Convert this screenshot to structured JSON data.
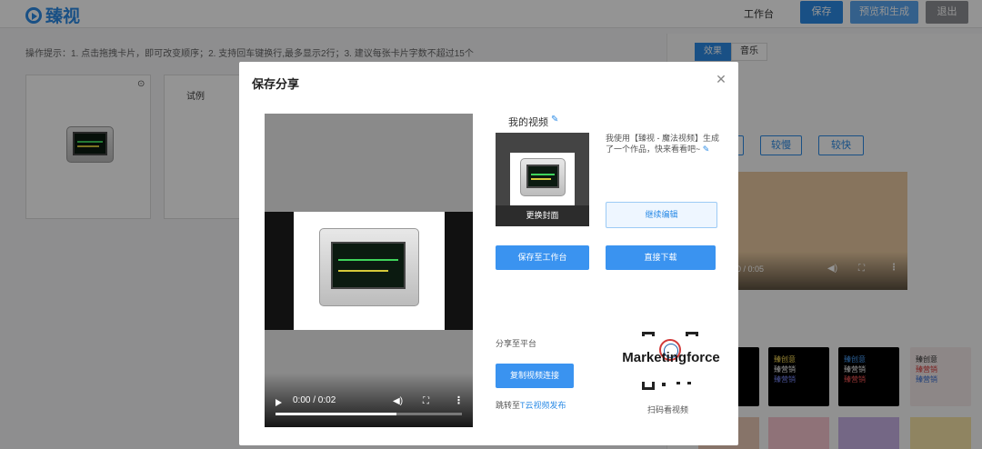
{
  "app": {
    "logo_text": "臻视",
    "nav_workbench": "工作台",
    "btn_save": "保存",
    "btn_preview": "预览和生成",
    "btn_exit": "退出"
  },
  "colors": {
    "primary": "#3a93f0",
    "header_blue": "#2b8be6",
    "exit_gray": "#8d9095"
  },
  "background": {
    "tips": "操作提示：1. 点击拖拽卡片，即可改变顺序；2. 支持回车键换行,最多显示2行；3. 建议每张卡片字数不超过15个",
    "card2_label": "试例",
    "tabs": [
      "效果",
      "音乐"
    ],
    "speeds": [
      "较慢",
      "较快"
    ],
    "bg_time": "0 / 0:05",
    "templates": [
      {
        "lines": [
          "臻创意",
          "臻营销",
          "臻视频"
        ]
      },
      {
        "lines": [
          "臻创意",
          "臻营销",
          "臻营销"
        ]
      },
      {
        "lines": [
          "臻创意",
          "臻营销",
          "臻营销"
        ]
      },
      {
        "lines": [
          "臻创意",
          "臻营销",
          "臻营销"
        ]
      }
    ]
  },
  "modal": {
    "title": "保存分享",
    "close_icon": "close-icon",
    "my_video_label": "我的视频",
    "change_cover": "更换封面",
    "share_desc": "我使用【臻视 - 魔法视频】生成了一个作品，快来看看吧~",
    "continue_edit": "继续编辑",
    "save_to_workbench": "保存至工作台",
    "direct_download": "直接下载",
    "share_platform": "分享至平台",
    "copy_link": "复制视频连接",
    "jump_prefix": "跳转至",
    "jump_link": "T云视频发布",
    "scan_label": "扫码看视频",
    "player": {
      "time": "0:00 / 0:02",
      "progress": 0.65
    }
  },
  "watermark": {
    "text": "Marketingforce"
  }
}
